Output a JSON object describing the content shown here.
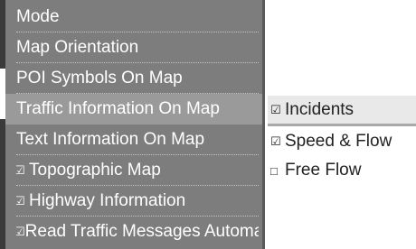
{
  "menu": {
    "items": [
      {
        "label": "Mode",
        "checkbox": ""
      },
      {
        "label": "Map Orientation",
        "checkbox": ""
      },
      {
        "label": "POI Symbols On Map",
        "checkbox": ""
      },
      {
        "label": "Traffic Information On Map",
        "checkbox": ""
      },
      {
        "label": "Text Information On Map",
        "checkbox": ""
      },
      {
        "label": "Topographic Map",
        "checkbox": "☑"
      },
      {
        "label": "Highway Information",
        "checkbox": "☑"
      },
      {
        "label": "Read Traffic Messages Automatically",
        "checkbox": "☑"
      }
    ]
  },
  "submenu": {
    "items": [
      {
        "label": "Incidents",
        "icon": "☑"
      },
      {
        "label": "Speed & Flow",
        "icon": "☑"
      },
      {
        "label": "Free Flow",
        "icon": "□"
      }
    ]
  }
}
